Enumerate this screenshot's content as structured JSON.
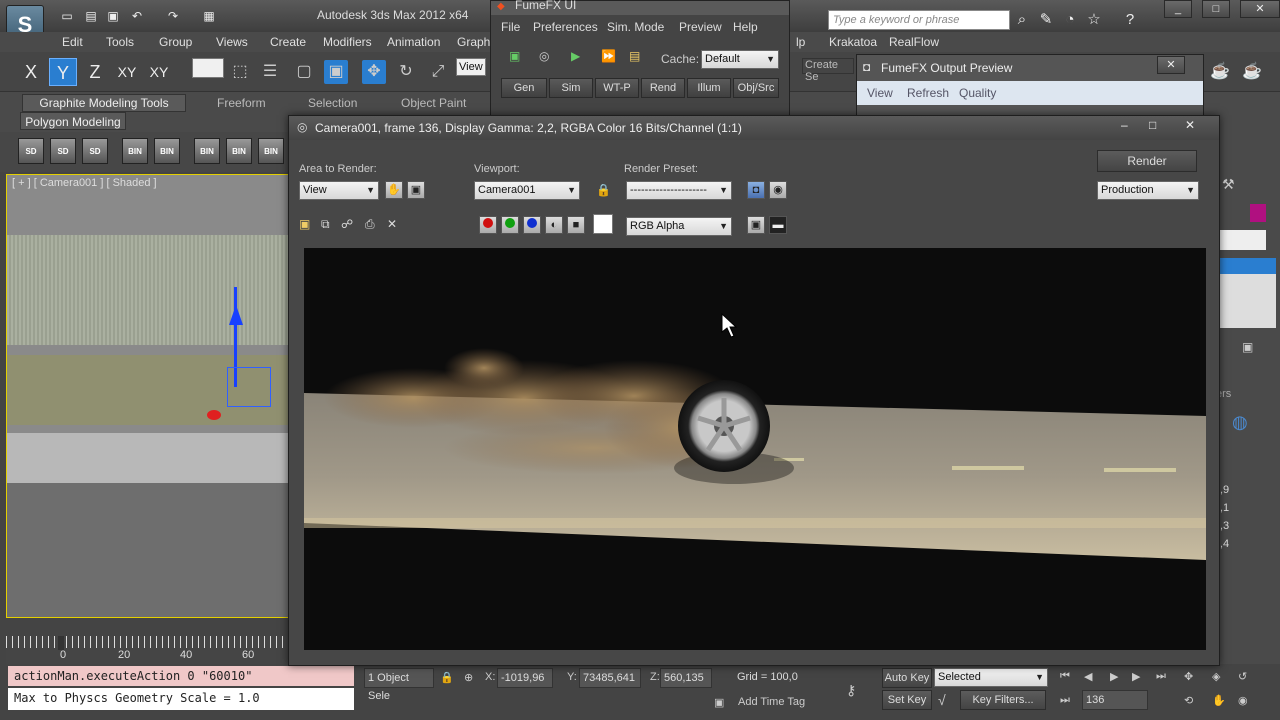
{
  "title_bar": {
    "app_title": "Autodesk 3ds Max  2012 x64",
    "search_placeholder": "Type a keyword or phrase"
  },
  "menu": {
    "items": [
      "Edit",
      "Tools",
      "Group",
      "Views",
      "Create",
      "Modifiers",
      "Animation",
      "Graph"
    ],
    "right_items": [
      "lp",
      "Krakatoa",
      "RealFlow"
    ]
  },
  "main_toolbar": {
    "axes": [
      "X",
      "Y",
      "Z",
      "XY",
      "XY"
    ],
    "view_dropdown": "View",
    "create_selection_set": "Create Se"
  },
  "ribbon": {
    "tabs": [
      "Graphite Modeling Tools",
      "Freeform",
      "Selection",
      "Object Paint"
    ],
    "panel": "Polygon Modeling"
  },
  "icon_strip": {
    "labels": [
      "SD",
      "SD",
      "SD",
      "BIN",
      "BIN",
      "BIN",
      "BIN",
      "BIN",
      "BIN"
    ]
  },
  "viewport": {
    "label": "[ + ] [ Camera001 ] [ Shaded ]"
  },
  "timeline": {
    "ticks": [
      "0",
      "20",
      "40",
      "60"
    ]
  },
  "listener": {
    "line1": "actionMan.executeAction 0 \"60010\"",
    "line2": "Max to Physcs Geometry Scale = 1.0"
  },
  "status": {
    "selection": "1 Object Sele",
    "x_label": "X:",
    "x_value": "-1019,96",
    "y_label": "Y:",
    "y_value": "73485,641",
    "z_label": "Z:",
    "z_value": "560,135",
    "grid": "Grid = 100,0",
    "add_time_tag": "Add Time Tag",
    "auto_key": "Auto Key",
    "set_key": "Set Key",
    "key_mode": "Selected",
    "key_filters": "Key Filters...",
    "frame": "136"
  },
  "right_panel": {
    "partial_labels": [
      "ers",
      ",9",
      ",1",
      ",3",
      ",4"
    ]
  },
  "fumefx": {
    "title": "FumeFX UI",
    "menu": [
      "File",
      "Preferences",
      "Sim. Mode",
      "Preview",
      "Help"
    ],
    "cache_label": "Cache:",
    "cache_value": "Default",
    "tabs": [
      "Gen",
      "Sim",
      "WT-P",
      "Rend",
      "Illum",
      "Obj/Src"
    ]
  },
  "fumefx_preview": {
    "title": "FumeFX Output Preview",
    "menu": [
      "View",
      "Refresh",
      "Quality"
    ]
  },
  "render_window": {
    "title": "Camera001, frame 136, Display Gamma: 2,2, RGBA Color 16 Bits/Channel (1:1)",
    "area_label": "Area to Render:",
    "area_value": "View",
    "viewport_label": "Viewport:",
    "viewport_value": "Camera001",
    "preset_label": "Render Preset:",
    "preset_value": "---------------------",
    "render_button": "Render",
    "production_value": "Production",
    "channel_value": "RGB Alpha"
  },
  "colors": {
    "viewport_border": "#e4d000",
    "red_channel": "#d01010",
    "green_channel": "#10a010",
    "blue_channel": "#1030d0"
  }
}
